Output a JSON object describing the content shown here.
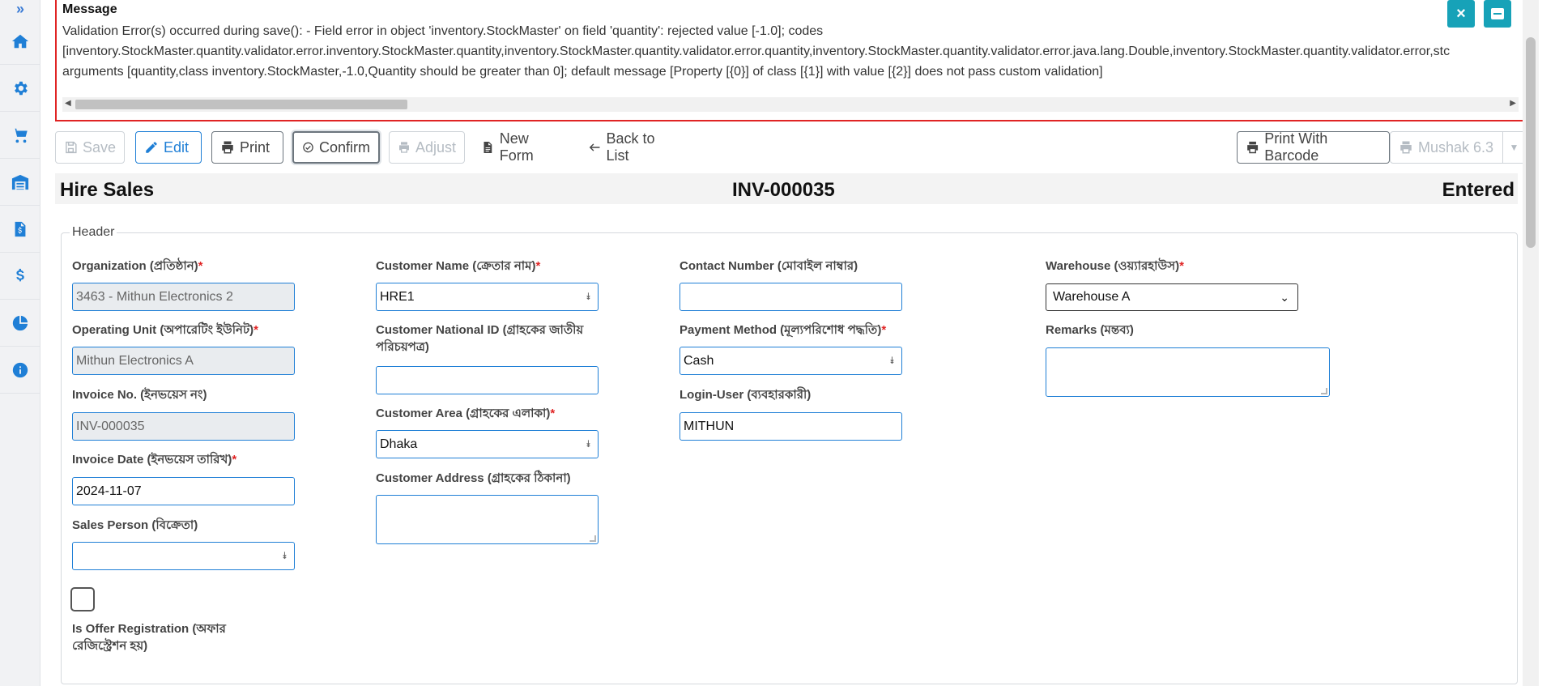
{
  "sidebar": {
    "toggle": "»",
    "items": [
      {
        "name": "home",
        "icon": "home-icon"
      },
      {
        "name": "settings",
        "icon": "gear-icon"
      },
      {
        "name": "sales",
        "icon": "cart-icon"
      },
      {
        "name": "warehouse",
        "icon": "warehouse-icon"
      },
      {
        "name": "documents",
        "icon": "file-invoice-icon"
      },
      {
        "name": "finance",
        "icon": "dollar-icon"
      },
      {
        "name": "reports",
        "icon": "pie-chart-icon"
      },
      {
        "name": "info",
        "icon": "info-icon"
      }
    ]
  },
  "message": {
    "title": "Message",
    "line1": "Validation Error(s) occurred during save(): - Field error in object 'inventory.StockMaster' on field 'quantity': rejected value [-1.0]; codes",
    "line2": "[inventory.StockMaster.quantity.validator.error.inventory.StockMaster.quantity,inventory.StockMaster.quantity.validator.error.quantity,inventory.StockMaster.quantity.validator.error.java.lang.Double,inventory.StockMaster.quantity.validator.error,stc",
    "line3": "arguments [quantity,class inventory.StockMaster,-1.0,Quantity should be greater than 0]; default message [Property [{0}] of class [{1}] with value [{2}] does not pass custom validation]",
    "close_icon": "×",
    "minimize_icon": "–"
  },
  "toolbar": {
    "save": "Save",
    "edit": "Edit",
    "print": "Print",
    "confirm": "Confirm",
    "adjust": "Adjust",
    "new_form": "New Form",
    "back_to_list": "Back to List",
    "print_with_barcode": "Print With Barcode",
    "mushak": "Mushak 6.3"
  },
  "title": {
    "left": "Hire Sales",
    "center": "INV-000035",
    "right": "Entered"
  },
  "form": {
    "legend": "Header",
    "organization": {
      "label": "Organization (প্রতিষ্ঠান)",
      "value": "3463 - Mithun Electronics 2"
    },
    "operating_unit": {
      "label": "Operating Unit (অপারেটিং ইউনিট)",
      "value": "Mithun Electronics A"
    },
    "invoice_no": {
      "label": "Invoice No. (ইনভয়েস নং)",
      "value": "INV-000035"
    },
    "invoice_date": {
      "label": "Invoice Date (ইনভয়েস তারিখ)",
      "value": "2024-11-07"
    },
    "sales_person": {
      "label": "Sales Person (বিক্রেতা)",
      "value": ""
    },
    "is_offer": {
      "label_line1": "Is Offer Registration (অফার",
      "label_line2": "রেজিস্ট্রেশন হয়)"
    },
    "customer_name": {
      "label": "Customer Name (ক্রেতার নাম)",
      "value": "HRE1"
    },
    "customer_nid": {
      "label_line1": "Customer National ID (গ্রাহকের জাতীয়",
      "label_line2": "পরিচয়পত্র)",
      "value": ""
    },
    "customer_area": {
      "label": "Customer Area (গ্রাহকের এলাকা)",
      "value": "Dhaka"
    },
    "customer_address": {
      "label": "Customer Address (গ্রাহকের ঠিকানা)",
      "value": ""
    },
    "contact_number": {
      "label": "Contact Number (মোবাইল নাম্বার)",
      "value": ""
    },
    "payment_method": {
      "label": "Payment Method (মূল্যপরিশোধ পদ্ধতি)",
      "value": "Cash"
    },
    "login_user": {
      "label": "Login-User (ব্যবহারকারী)",
      "value": "MITHUN"
    },
    "warehouse": {
      "label": "Warehouse (ওয়্যারহাউস)",
      "value": "Warehouse A"
    },
    "remarks": {
      "label": "Remarks (মন্তব্য)",
      "value": ""
    },
    "required_mark": "*"
  }
}
